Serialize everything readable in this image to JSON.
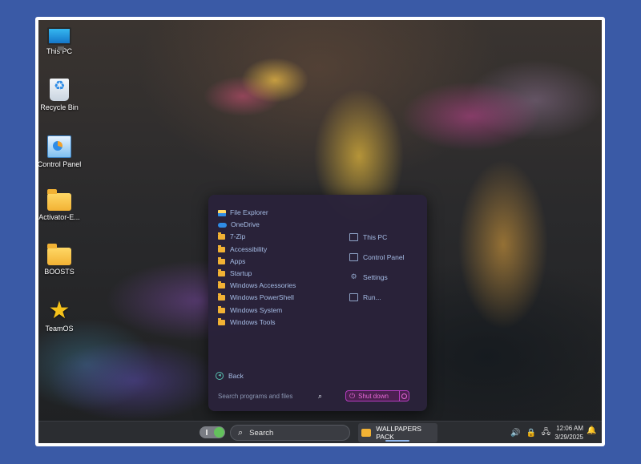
{
  "desktop": {
    "icons": [
      {
        "label": "This PC",
        "icon": "monitor-icon"
      },
      {
        "label": "Recycle Bin",
        "icon": "recycle-bin-icon"
      },
      {
        "label": "Control Panel",
        "icon": "control-panel-icon"
      },
      {
        "label": "Activator-E...",
        "icon": "folder-icon"
      },
      {
        "label": "BOOSTS",
        "icon": "folder-icon"
      },
      {
        "label": "TeamOS",
        "icon": "star-icon"
      }
    ]
  },
  "start_menu": {
    "apps": [
      {
        "label": "File Explorer",
        "icon": "file-explorer-icon"
      },
      {
        "label": "OneDrive",
        "icon": "cloud-icon"
      },
      {
        "label": "7-Zip",
        "icon": "folder-icon"
      },
      {
        "label": "Accessibility",
        "icon": "folder-icon"
      },
      {
        "label": "Apps",
        "icon": "folder-icon"
      },
      {
        "label": "Startup",
        "icon": "folder-icon"
      },
      {
        "label": "Windows Accessories",
        "icon": "folder-icon"
      },
      {
        "label": "Windows PowerShell",
        "icon": "folder-icon"
      },
      {
        "label": "Windows System",
        "icon": "folder-icon"
      },
      {
        "label": "Windows Tools",
        "icon": "folder-icon"
      }
    ],
    "links": [
      {
        "label": "This PC",
        "icon": "monitor-icon"
      },
      {
        "label": "Control Panel",
        "icon": "control-panel-icon"
      },
      {
        "label": "Settings",
        "icon": "gear-icon"
      },
      {
        "label": "Run...",
        "icon": "run-icon"
      }
    ],
    "back_label": "Back",
    "search_placeholder": "Search programs and files",
    "shutdown_label": "Shut down"
  },
  "taskbar": {
    "search_label": "Search",
    "open_app": "WALLPAPERS PACK",
    "time": "12:06 AM",
    "date": "3/29/2025"
  },
  "colors": {
    "accent_shutdown": "#b63cc0",
    "menu_bg": "#2a223a",
    "page_bg": "#3a5aa6"
  }
}
